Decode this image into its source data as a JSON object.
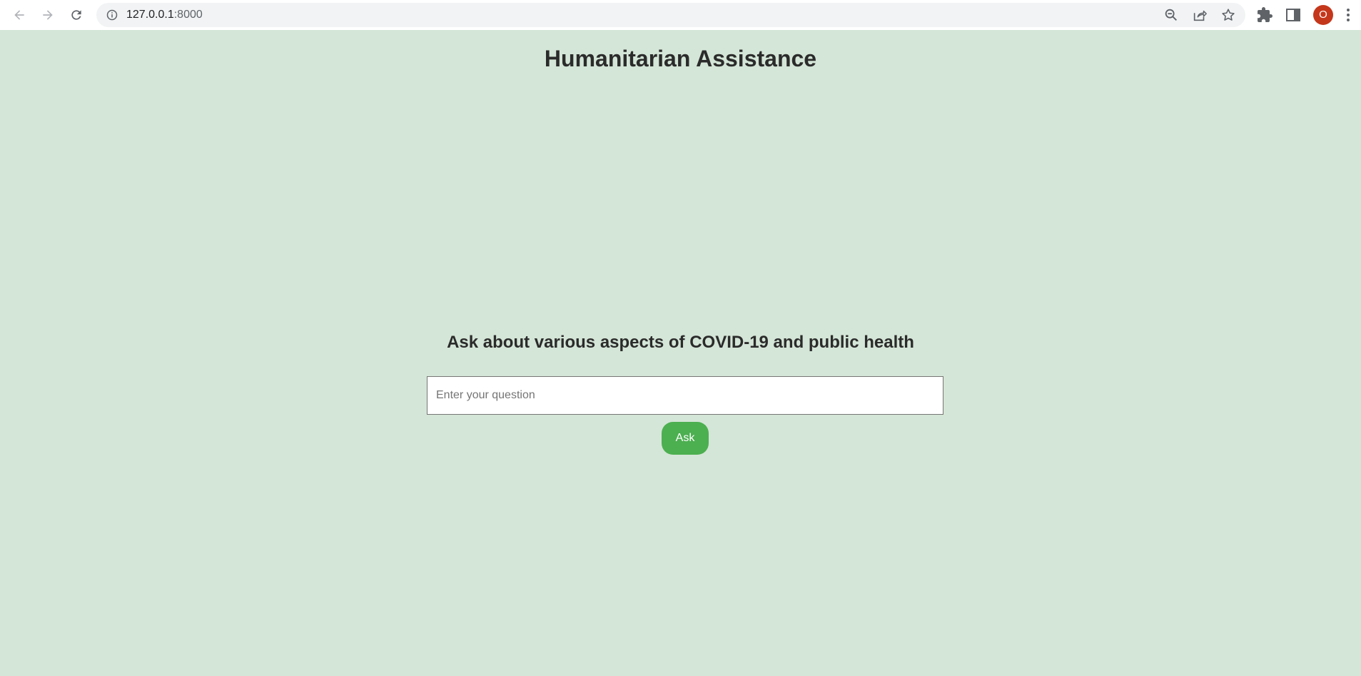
{
  "browser": {
    "url_host": "127.0.0.1",
    "url_port": ":8000",
    "profile_initial": "O",
    "icons": {
      "back": "arrow-left-icon",
      "forward": "arrow-right-icon",
      "reload": "reload-icon",
      "info": "info-icon",
      "zoom": "zoom-out-icon",
      "share": "share-icon",
      "bookmark": "star-icon",
      "extensions": "puzzle-icon",
      "side_panel": "side-panel-icon",
      "menu": "kebab-menu-icon"
    }
  },
  "page": {
    "title": "Humanitarian Assistance",
    "prompt_heading": "Ask about various aspects of COVID-19 and public health",
    "question_input": {
      "placeholder": "Enter your question",
      "value": ""
    },
    "ask_button_label": "Ask"
  },
  "colors": {
    "page_background": "#d4e6d7",
    "button_background": "#4caf50",
    "avatar_background": "#c5371b",
    "heading_text": "#2b2b2b"
  }
}
